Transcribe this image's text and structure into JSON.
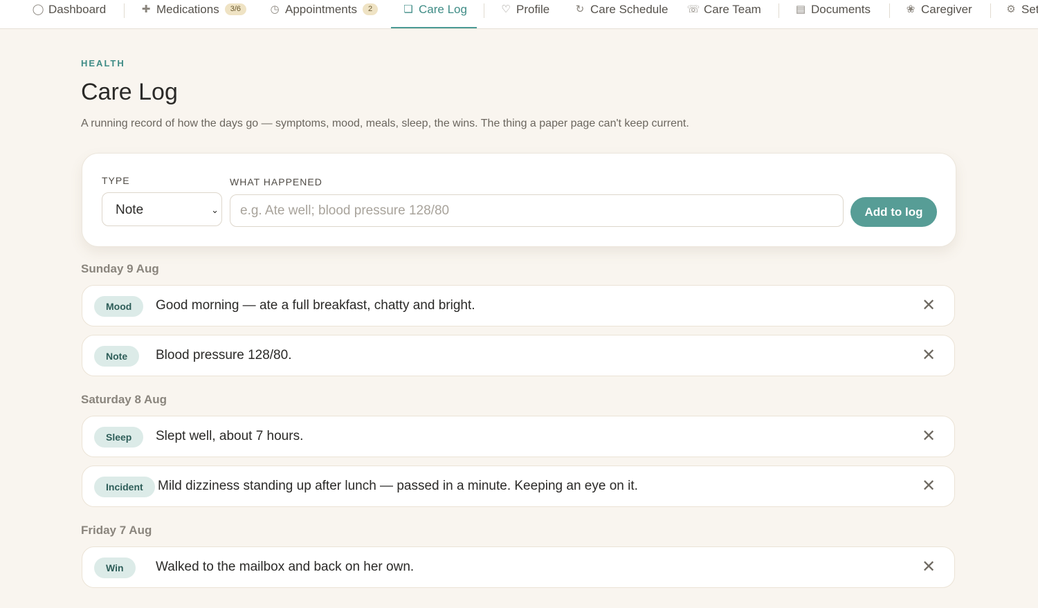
{
  "nav": {
    "items": [
      {
        "label": "Dashboard",
        "icon": "circle-icon",
        "glyph": "◯"
      },
      {
        "label": "Medications",
        "icon": "plus-icon",
        "glyph": "✚",
        "badge": "3/6"
      },
      {
        "label": "Appointments",
        "icon": "clock-icon",
        "glyph": "◷",
        "badge": "2"
      },
      {
        "label": "Care Log",
        "icon": "notebook-icon",
        "glyph": "❏"
      },
      {
        "label": "Profile",
        "icon": "heart-icon",
        "glyph": "♡"
      },
      {
        "label": "Care Schedule",
        "icon": "cycle-icon",
        "glyph": "↻"
      },
      {
        "label": "Care Team",
        "icon": "phone-icon",
        "glyph": "☏"
      },
      {
        "label": "Documents",
        "icon": "document-icon",
        "glyph": "▤"
      },
      {
        "label": "Caregiver",
        "icon": "flower-icon",
        "glyph": "❀"
      },
      {
        "label": "Set",
        "icon": "gear-icon",
        "glyph": "⚙"
      }
    ]
  },
  "header": {
    "eyebrow": "HEALTH",
    "title": "Care Log",
    "subtitle": "A running record of how the days go — symptoms, mood, meals, sleep, the wins. The thing a paper page can't keep current."
  },
  "form": {
    "type_label": "TYPE",
    "type_value": "Note",
    "what_label": "WHAT HAPPENED",
    "what_placeholder": "e.g. Ate well; blood pressure 128/80",
    "add_button": "Add to log"
  },
  "days": [
    {
      "date": "Sunday 9 Aug",
      "entries": [
        {
          "tag": "Mood",
          "text": "Good morning — ate a full breakfast, chatty and bright."
        },
        {
          "tag": "Note",
          "text": "Blood pressure 128/80."
        }
      ]
    },
    {
      "date": "Saturday 8 Aug",
      "entries": [
        {
          "tag": "Sleep",
          "text": "Slept well, about 7 hours."
        },
        {
          "tag": "Incident",
          "text": "Mild dizziness standing up after lunch — passed in a minute. Keeping an eye on it."
        }
      ]
    },
    {
      "date": "Friday 7 Aug",
      "entries": [
        {
          "tag": "Win",
          "text": "Walked to the mailbox and back on her own."
        }
      ]
    }
  ],
  "close_glyph": "✕",
  "colors": {
    "accent": "#579d96",
    "background": "#f9f5ef",
    "tag_bg": "#dcebe8"
  }
}
